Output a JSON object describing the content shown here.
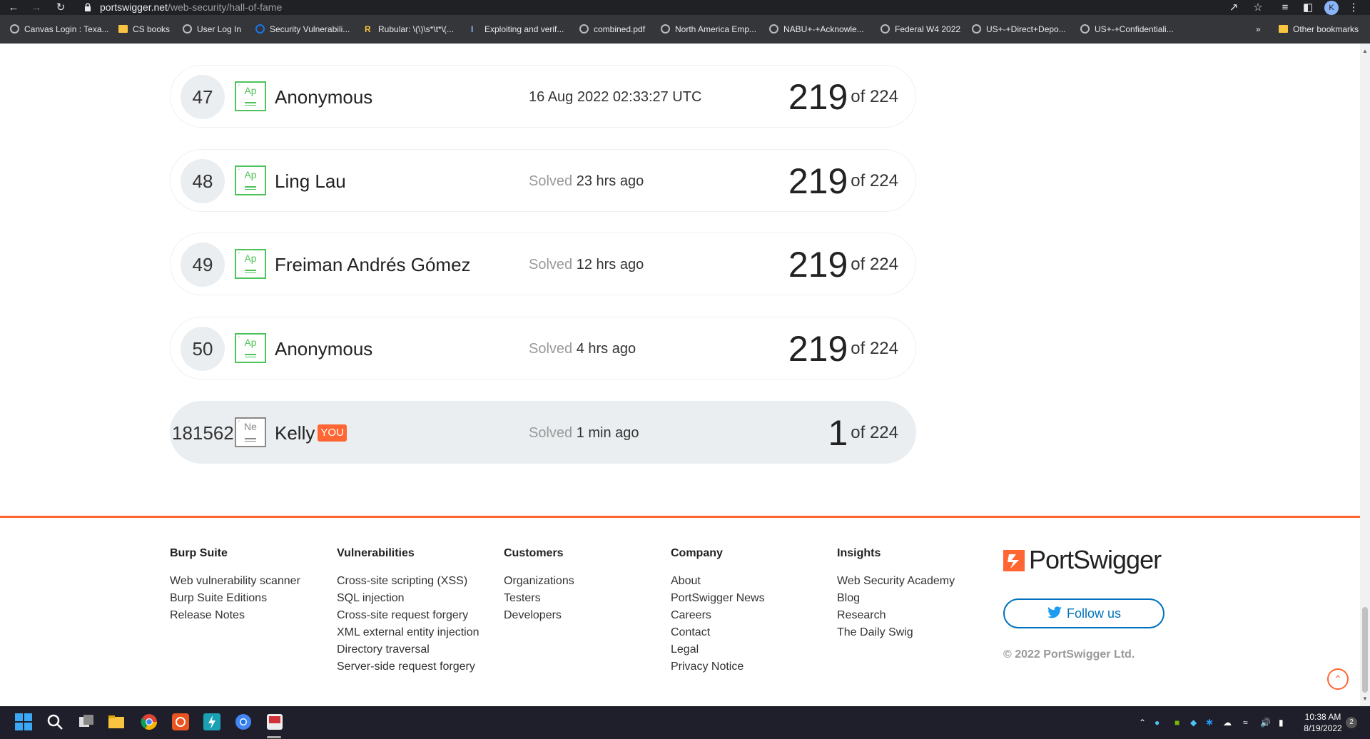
{
  "browser": {
    "url_host": "portswigger.net",
    "url_path": "/web-security/hall-of-fame",
    "profile_initial": "K",
    "bookmarks": [
      {
        "label": "Canvas Login : Texa...",
        "icon": "globe-icon"
      },
      {
        "label": "CS books",
        "icon": "folder-icon"
      },
      {
        "label": "User Log In",
        "icon": "globe-icon"
      },
      {
        "label": "Security Vulnerabili...",
        "icon": "site-icon"
      },
      {
        "label": "Rubular: \\(\\)\\s*\\t*\\(...",
        "icon": "r-icon"
      },
      {
        "label": "Exploiting and verif...",
        "icon": "i-icon"
      },
      {
        "label": "combined.pdf",
        "icon": "globe-icon"
      },
      {
        "label": "North America Emp...",
        "icon": "globe-icon"
      },
      {
        "label": "NABU+-+Acknowle...",
        "icon": "globe-icon"
      },
      {
        "label": "Federal W4 2022",
        "icon": "globe-icon"
      },
      {
        "label": "US+-+Direct+Depo...",
        "icon": "globe-icon"
      },
      {
        "label": "US+-+Confidentiali...",
        "icon": "globe-icon"
      }
    ],
    "overflow": "»",
    "other_bookmarks": "Other bookmarks"
  },
  "leaderboard": [
    {
      "rank": "47",
      "badge": "Ap",
      "name": "Anonymous",
      "solved_prefix": "",
      "solved_time": "16 Aug 2022 02:33:27 UTC",
      "count": "219",
      "total": "of 224"
    },
    {
      "rank": "48",
      "badge": "Ap",
      "name": "Ling Lau",
      "solved_prefix": "Solved",
      "solved_time": "23 hrs ago",
      "count": "219",
      "total": "of 224"
    },
    {
      "rank": "49",
      "badge": "Ap",
      "name": "Freiman Andrés Gómez",
      "solved_prefix": "Solved",
      "solved_time": "12 hrs ago",
      "count": "219",
      "total": "of 224"
    },
    {
      "rank": "50",
      "badge": "Ap",
      "name": "Anonymous",
      "solved_prefix": "Solved",
      "solved_time": "4 hrs ago",
      "count": "219",
      "total": "of 224"
    },
    {
      "rank": "181562",
      "badge": "Ne",
      "name": "Kelly",
      "you": "YOU",
      "solved_prefix": "Solved",
      "solved_time": "1 min ago",
      "count": "1",
      "total": "of 224"
    }
  ],
  "footer": {
    "columns": [
      {
        "heading": "Burp Suite",
        "links": [
          "Web vulnerability scanner",
          "Burp Suite Editions",
          "Release Notes"
        ]
      },
      {
        "heading": "Vulnerabilities",
        "links": [
          "Cross-site scripting (XSS)",
          "SQL injection",
          "Cross-site request forgery",
          "XML external entity injection",
          "Directory traversal",
          "Server-side request forgery"
        ]
      },
      {
        "heading": "Customers",
        "links": [
          "Organizations",
          "Testers",
          "Developers"
        ]
      },
      {
        "heading": "Company",
        "links": [
          "About",
          "PortSwigger News",
          "Careers",
          "Contact",
          "Legal",
          "Privacy Notice"
        ]
      },
      {
        "heading": "Insights",
        "links": [
          "Web Security Academy",
          "Blog",
          "Research",
          "The Daily Swig"
        ]
      }
    ],
    "brand": "PortSwigger",
    "follow_label": "Follow us",
    "copyright": "© 2022 PortSwigger Ltd."
  },
  "taskbar": {
    "time": "10:38 AM",
    "date": "8/19/2022",
    "notifications": "2"
  },
  "colors": {
    "accent": "#ff6633",
    "badge_green": "#4ec35a",
    "twitter_blue": "#0071bc"
  }
}
